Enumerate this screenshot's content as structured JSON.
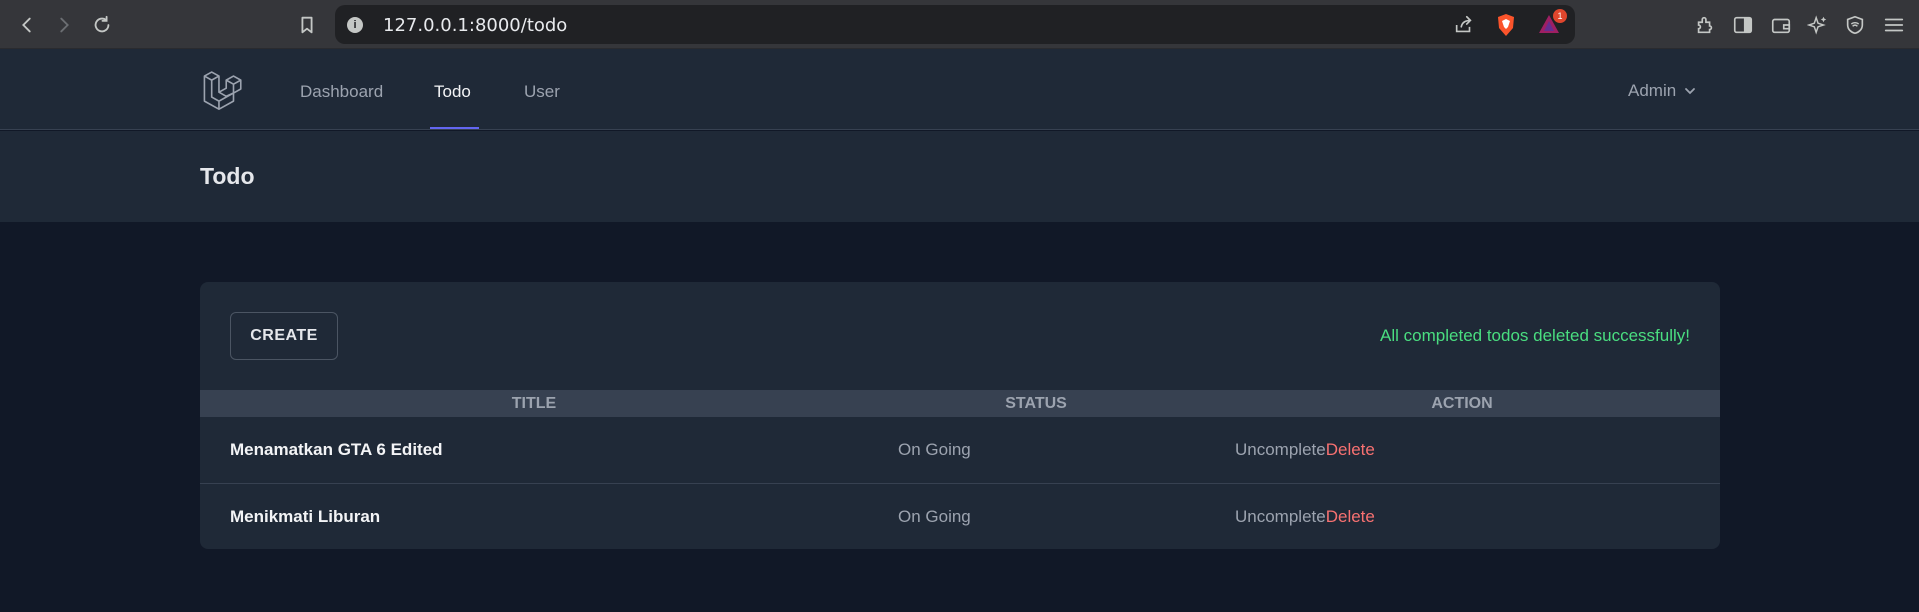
{
  "browser": {
    "url": "127.0.0.1:8000/todo",
    "rewards_badge": "1"
  },
  "nav": {
    "links": [
      "Dashboard",
      "Todo",
      "User"
    ],
    "active": "Todo",
    "user_name": "Admin"
  },
  "page": {
    "title": "Todo"
  },
  "card": {
    "create_label": "CREATE",
    "flash_message": "All completed todos deleted successfully!",
    "columns": [
      "TITLE",
      "STATUS",
      "ACTION"
    ],
    "rows": [
      {
        "title": "Menamatkan GTA 6 Edited",
        "status": "On Going",
        "action_primary": "Uncomplete",
        "action_delete": "Delete"
      },
      {
        "title": "Menikmati Liburan",
        "status": "On Going",
        "action_primary": "Uncomplete",
        "action_delete": "Delete"
      }
    ]
  },
  "colors": {
    "flash": "#4ade80",
    "delete": "#f87171",
    "active_indicator": "#6366f1"
  },
  "icons": [
    "back-icon",
    "forward-icon",
    "reload-icon",
    "bookmark-icon",
    "site-info-icon",
    "share-icon",
    "brave-shield-icon",
    "brave-rewards-icon",
    "extensions-icon",
    "sidebar-icon",
    "wallet-icon",
    "leo-ai-icon",
    "vpn-icon",
    "menu-icon",
    "laravel-logo-icon",
    "chevron-down-icon"
  ]
}
